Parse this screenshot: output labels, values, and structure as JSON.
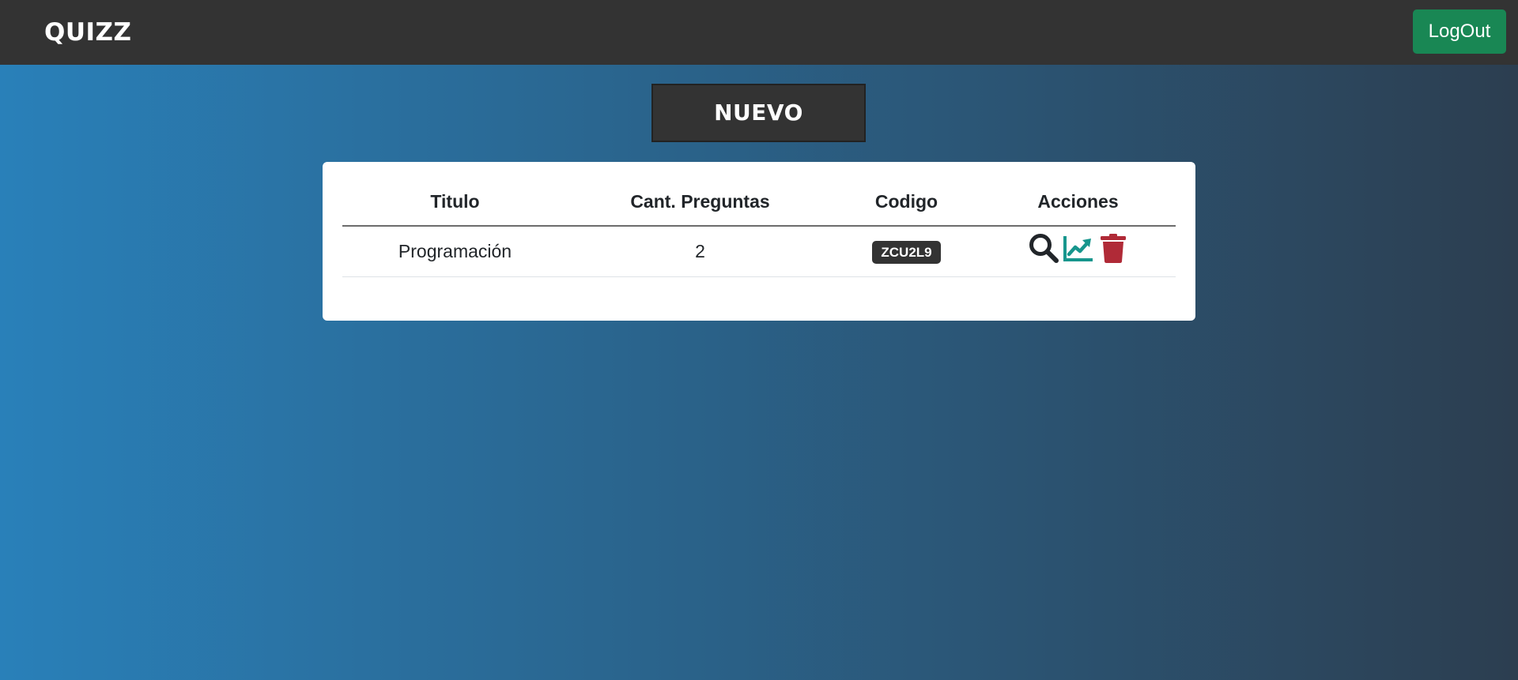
{
  "navbar": {
    "brand": "QUIZZ",
    "logout_label": "LogOut"
  },
  "new_button": {
    "label": "NUEVO"
  },
  "table": {
    "headers": [
      "Titulo",
      "Cant. Preguntas",
      "Codigo",
      "Acciones"
    ],
    "rows": [
      {
        "titulo": "Programación",
        "cant_preguntas": "2",
        "codigo": "ZCU2L9",
        "actions": [
          "search-icon",
          "chart-line-icon",
          "trash-icon"
        ]
      }
    ]
  },
  "colors": {
    "navbar_bg": "#333333",
    "logout_bg": "#198754",
    "gradient_start": "#2980b9",
    "gradient_end": "#2c3e50",
    "stats_icon": "#17968d",
    "delete_icon": "#b02a37"
  }
}
